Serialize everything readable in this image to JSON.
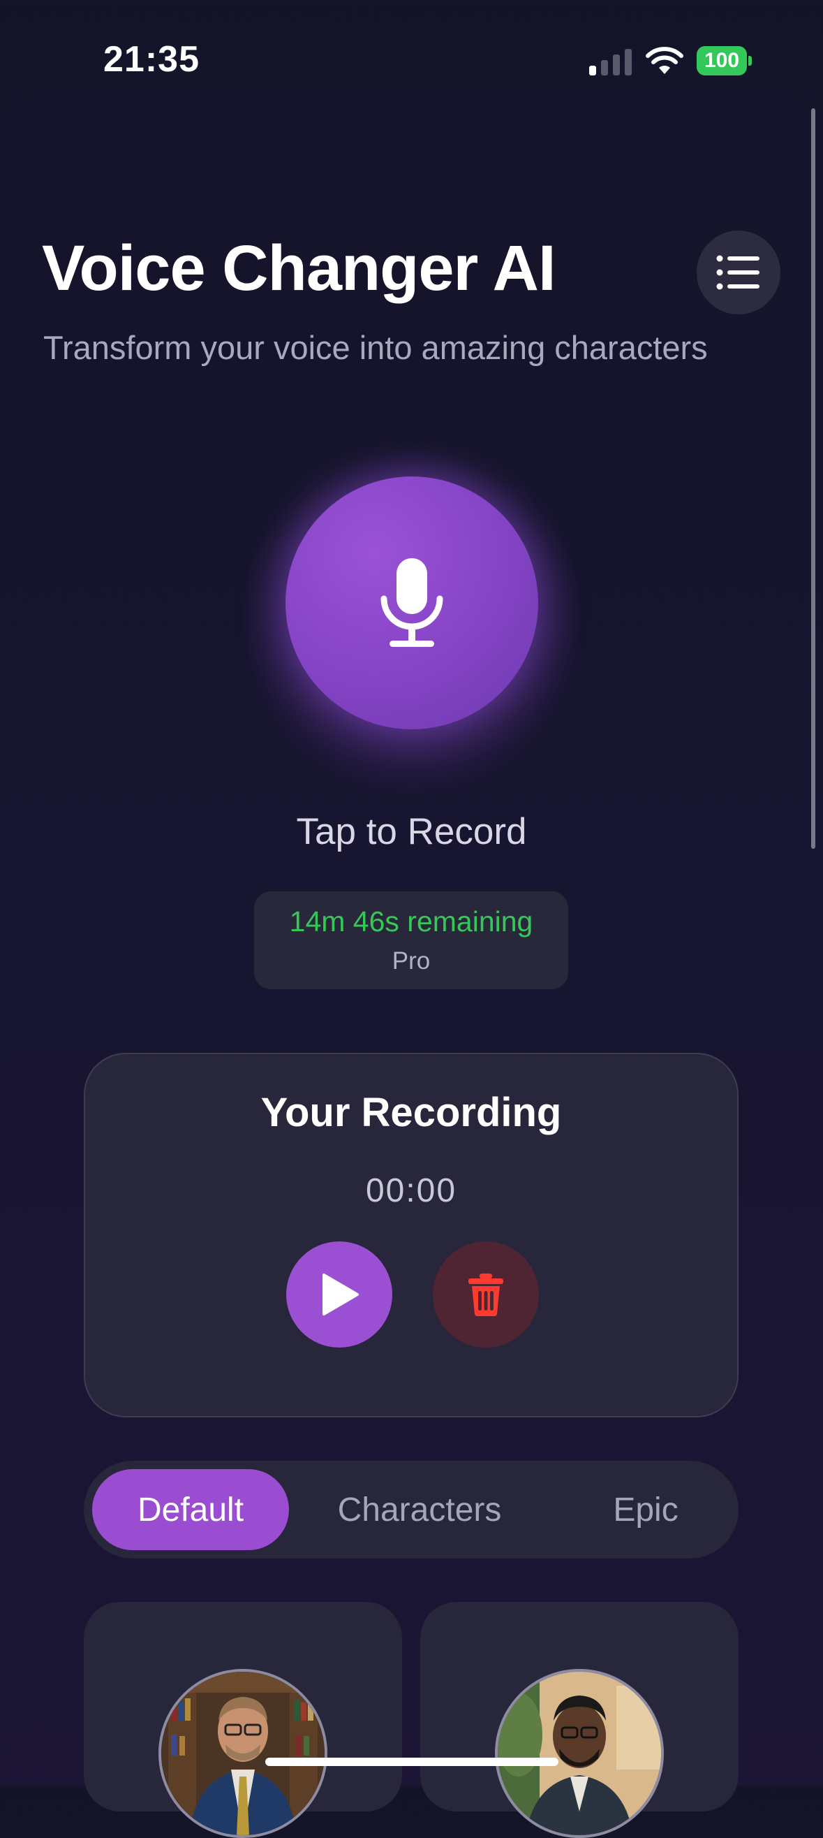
{
  "status_bar": {
    "time": "21:35",
    "battery": "100"
  },
  "header": {
    "title": "Voice Changer AI",
    "subtitle": "Transform your voice into amazing characters",
    "menu_icon": "list-icon"
  },
  "recorder": {
    "mic_icon": "microphone-icon",
    "prompt": "Tap to Record",
    "remaining": "14m 46s remaining",
    "plan": "Pro"
  },
  "recording_card": {
    "title": "Your Recording",
    "duration": "00:00",
    "play_icon": "play-icon",
    "delete_icon": "trash-icon"
  },
  "tabs": [
    {
      "label": "Default",
      "active": true
    },
    {
      "label": "Characters",
      "active": false
    },
    {
      "label": "Epic",
      "active": false
    }
  ],
  "voices": [
    {
      "avatar": "man-in-suit-with-glasses"
    },
    {
      "avatar": "man-with-beard"
    }
  ],
  "colors": {
    "accent": "#9a4dd0",
    "remaining_green": "#35c759",
    "delete_red": "#ff3b30",
    "background": "#161630"
  }
}
